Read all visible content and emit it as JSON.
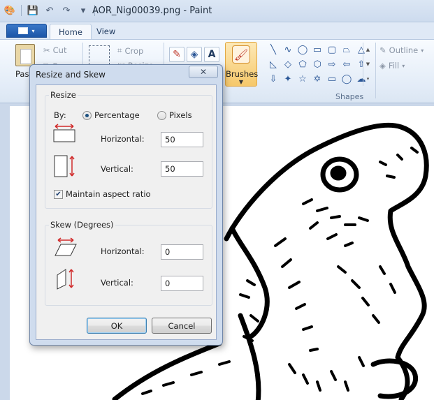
{
  "window": {
    "title": "AOR_Nig00039.png - Paint"
  },
  "quick_access": {
    "icons": [
      "paint-app-icon",
      "save-icon",
      "undo-icon",
      "redo-icon",
      "customize-dropdown-icon"
    ]
  },
  "ribbon": {
    "tabs": [
      {
        "label": "Home",
        "active": true
      },
      {
        "label": "View",
        "active": false
      }
    ],
    "clipboard": {
      "paste": "Paste",
      "cut": "Cut",
      "copy": "Copy"
    },
    "image": {
      "crop": "Crop",
      "resize": "Resize"
    },
    "brushes": "Brushes",
    "outline": "Outline",
    "fill": "Fill",
    "shapes_group": "Shapes"
  },
  "dialog": {
    "title": "Resize and Skew",
    "resize": {
      "group_title": "Resize",
      "by_label": "By:",
      "percentage_label": "Percentage",
      "pixels_label": "Pixels",
      "selected_unit": "Percentage",
      "horizontal_label": "Horizontal:",
      "horizontal_value": "50",
      "vertical_label": "Vertical:",
      "vertical_value": "50",
      "maintain_aspect_label": "Maintain aspect ratio",
      "maintain_aspect_checked": true
    },
    "skew": {
      "group_title": "Skew (Degrees)",
      "horizontal_label": "Horizontal:",
      "horizontal_value": "0",
      "vertical_label": "Vertical:",
      "vertical_value": "0"
    },
    "ok_label": "OK",
    "cancel_label": "Cancel"
  },
  "colors": {
    "accent": "#2b5797",
    "highlight": "#f6c86a",
    "canvas": "#ffffff",
    "arrow": "#d12b2b"
  }
}
